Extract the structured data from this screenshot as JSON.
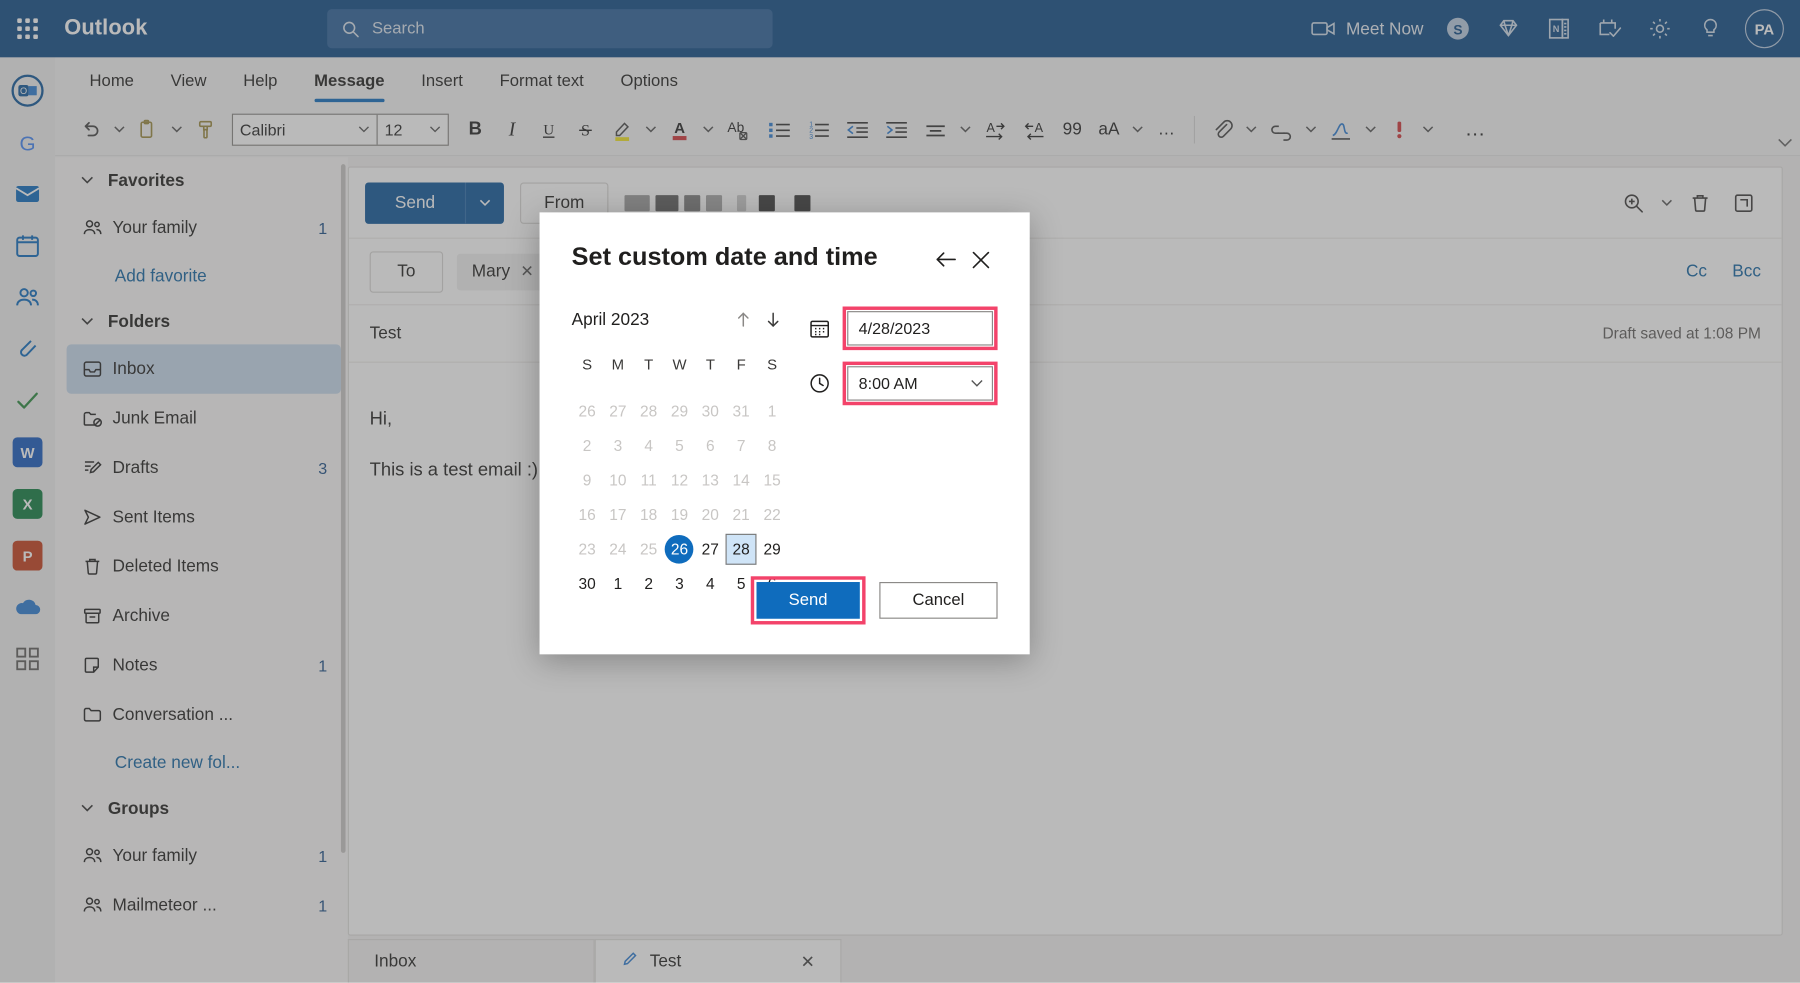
{
  "topbar": {
    "waffle": "app-launcher",
    "brand": "Outlook",
    "search_placeholder": "Search",
    "meet_now": "Meet Now",
    "icons": [
      "video-camera-icon",
      "skype-icon",
      "diamond-icon",
      "onenote-icon",
      "tasks-icon",
      "gear-icon",
      "lightbulb-icon"
    ],
    "avatar_initials": "PA"
  },
  "rail": {
    "items": [
      {
        "name": "outlook",
        "label": "O",
        "color": "#0f5699"
      },
      {
        "name": "google",
        "label": "G",
        "color": "#ffffff"
      },
      {
        "name": "mail",
        "label": "",
        "color": "#0f6cbd"
      },
      {
        "name": "calendar",
        "label": "",
        "color": "#0f6cbd"
      },
      {
        "name": "people",
        "label": "",
        "color": "#0f6cbd"
      },
      {
        "name": "files",
        "label": "",
        "color": "#0f6cbd"
      },
      {
        "name": "todo",
        "label": "",
        "color": "#2a8a3e"
      },
      {
        "name": "word",
        "label": "W",
        "color": "#185abd"
      },
      {
        "name": "excel",
        "label": "X",
        "color": "#107c41"
      },
      {
        "name": "powerpoint",
        "label": "P",
        "color": "#c43e1c"
      },
      {
        "name": "onedrive",
        "label": "",
        "color": "#0f6cbd"
      },
      {
        "name": "more-apps",
        "label": "",
        "color": "#605e5c"
      }
    ]
  },
  "ribbon": {
    "tabs": [
      {
        "label": "Home",
        "active": false
      },
      {
        "label": "View",
        "active": false
      },
      {
        "label": "Help",
        "active": false
      },
      {
        "label": "Message",
        "active": true
      },
      {
        "label": "Insert",
        "active": false
      },
      {
        "label": "Format text",
        "active": false
      },
      {
        "label": "Options",
        "active": false
      }
    ],
    "font_name": "Calibri",
    "font_size": "12",
    "bold": "B",
    "italic": "I",
    "underline": "U",
    "strikethrough": "S",
    "quote": "99",
    "case": "aA",
    "more": "…",
    "tools": [
      "undo-icon",
      "paste-icon",
      "format-painter-icon",
      "bold-icon",
      "italic-icon",
      "underline-icon",
      "strikethrough-icon",
      "highlight-icon",
      "font-color-icon",
      "clear-formatting-icon",
      "bulleted-list-icon",
      "numbered-list-icon",
      "decrease-indent-icon",
      "increase-indent-icon",
      "align-icon",
      "ltr-direction-icon",
      "rtl-direction-icon",
      "quote-icon",
      "text-case-icon",
      "more-options-icon",
      "attach-icon",
      "link-icon",
      "signature-icon",
      "importance-icon",
      "overflow-icon"
    ]
  },
  "sidebar": {
    "groups": [
      {
        "name": "favorites",
        "label": "Favorites",
        "items": [
          {
            "label": "Your family",
            "count": "1",
            "icon": "people-icon",
            "selected": false
          }
        ],
        "link": "Add favorite"
      },
      {
        "name": "folders",
        "label": "Folders",
        "items": [
          {
            "label": "Inbox",
            "count": "",
            "icon": "inbox-icon",
            "selected": true
          },
          {
            "label": "Junk Email",
            "count": "",
            "icon": "junk-icon",
            "selected": false
          },
          {
            "label": "Drafts",
            "count": "3",
            "icon": "drafts-icon",
            "selected": false
          },
          {
            "label": "Sent Items",
            "count": "",
            "icon": "sent-icon",
            "selected": false
          },
          {
            "label": "Deleted Items",
            "count": "",
            "icon": "trash-icon",
            "selected": false
          },
          {
            "label": "Archive",
            "count": "",
            "icon": "archive-icon",
            "selected": false
          },
          {
            "label": "Notes",
            "count": "1",
            "icon": "notes-icon",
            "selected": false
          },
          {
            "label": "Conversation ...",
            "count": "",
            "icon": "folder-icon",
            "selected": false
          }
        ],
        "link": "Create new fol..."
      },
      {
        "name": "groups",
        "label": "Groups",
        "items": [
          {
            "label": "Your family",
            "count": "1",
            "icon": "people-icon",
            "selected": false
          },
          {
            "label": "Mailmeteor ...",
            "count": "1",
            "icon": "people-icon",
            "selected": false
          }
        ],
        "link": ""
      }
    ]
  },
  "compose": {
    "send_label": "Send",
    "from_label": "From",
    "to_label": "To",
    "recipient": "Mary",
    "cc_label": "Cc",
    "bcc_label": "Bcc",
    "subject": "Test",
    "draft_status": "Draft saved at 1:08 PM",
    "body_lines": [
      "Hi,",
      "This is a test email :)"
    ]
  },
  "bottom_tabs": [
    {
      "label": "Inbox",
      "active": false,
      "closable": false
    },
    {
      "label": "Test",
      "active": true,
      "closable": true,
      "icon": "pencil-icon"
    }
  ],
  "modal": {
    "title": "Set custom date and time",
    "back_icon": "back-arrow-icon",
    "close_icon": "close-icon",
    "calendar": {
      "month_label": "April 2023",
      "prev_icon": "arrow-up-icon",
      "next_icon": "arrow-down-icon",
      "dow": [
        "S",
        "M",
        "T",
        "W",
        "T",
        "F",
        "S"
      ],
      "weeks": [
        [
          {
            "d": "26",
            "state": "muted"
          },
          {
            "d": "27",
            "state": "muted"
          },
          {
            "d": "28",
            "state": "muted"
          },
          {
            "d": "29",
            "state": "muted"
          },
          {
            "d": "30",
            "state": "muted"
          },
          {
            "d": "31",
            "state": "muted"
          },
          {
            "d": "1",
            "state": "muted"
          }
        ],
        [
          {
            "d": "2",
            "state": "muted"
          },
          {
            "d": "3",
            "state": "muted"
          },
          {
            "d": "4",
            "state": "muted"
          },
          {
            "d": "5",
            "state": "muted"
          },
          {
            "d": "6",
            "state": "muted"
          },
          {
            "d": "7",
            "state": "muted"
          },
          {
            "d": "8",
            "state": "muted"
          }
        ],
        [
          {
            "d": "9",
            "state": "muted"
          },
          {
            "d": "10",
            "state": "muted"
          },
          {
            "d": "11",
            "state": "muted"
          },
          {
            "d": "12",
            "state": "muted"
          },
          {
            "d": "13",
            "state": "muted"
          },
          {
            "d": "14",
            "state": "muted"
          },
          {
            "d": "15",
            "state": "muted"
          }
        ],
        [
          {
            "d": "16",
            "state": "muted"
          },
          {
            "d": "17",
            "state": "muted"
          },
          {
            "d": "18",
            "state": "muted"
          },
          {
            "d": "19",
            "state": "muted"
          },
          {
            "d": "20",
            "state": "muted"
          },
          {
            "d": "21",
            "state": "muted"
          },
          {
            "d": "22",
            "state": "muted"
          }
        ],
        [
          {
            "d": "23",
            "state": "muted"
          },
          {
            "d": "24",
            "state": "muted"
          },
          {
            "d": "25",
            "state": "muted"
          },
          {
            "d": "26",
            "state": "today"
          },
          {
            "d": "27",
            "state": "normal"
          },
          {
            "d": "28",
            "state": "picked"
          },
          {
            "d": "29",
            "state": "normal"
          }
        ],
        [
          {
            "d": "30",
            "state": "normal"
          },
          {
            "d": "1",
            "state": "normal"
          },
          {
            "d": "2",
            "state": "normal"
          },
          {
            "d": "3",
            "state": "normal"
          },
          {
            "d": "4",
            "state": "normal"
          },
          {
            "d": "5",
            "state": "normal"
          },
          {
            "d": "6",
            "state": "normal"
          }
        ]
      ]
    },
    "date_value": "4/28/2023",
    "date_icon": "calendar-icon",
    "time_value": "8:00 AM",
    "time_icon": "clock-icon",
    "send_label": "Send",
    "cancel_label": "Cancel",
    "highlight_color": "#f3436a"
  }
}
